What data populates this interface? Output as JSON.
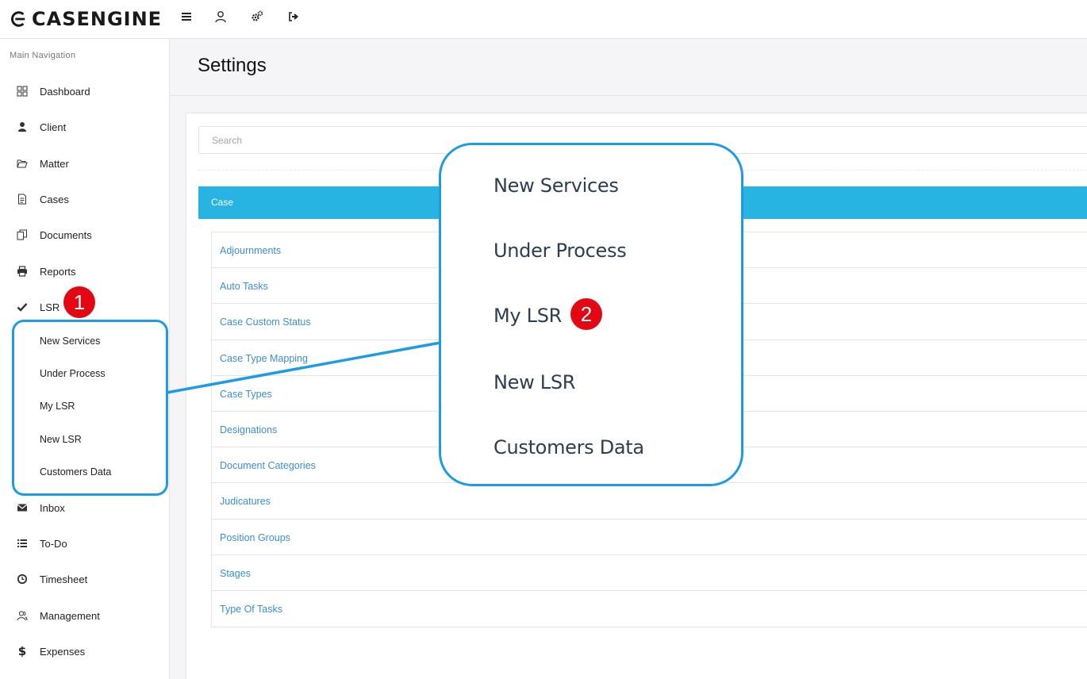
{
  "brand": {
    "name": "CASENGINE"
  },
  "topbar": {
    "icons": [
      "menu-icon",
      "user-icon",
      "settings-gears-icon",
      "logout-icon"
    ]
  },
  "sidebar": {
    "heading": "Main Navigation",
    "items": [
      {
        "label": "Dashboard",
        "icon": "grid-icon"
      },
      {
        "label": "Client",
        "icon": "user-icon"
      },
      {
        "label": "Matter",
        "icon": "folder-open-icon"
      },
      {
        "label": "Cases",
        "icon": "file-text-icon"
      },
      {
        "label": "Documents",
        "icon": "copy-icon"
      },
      {
        "label": "Reports",
        "icon": "printer-icon"
      },
      {
        "label": "LSR",
        "icon": "check-icon"
      },
      {
        "label": "Inbox",
        "icon": "envelope-icon"
      },
      {
        "label": "To-Do",
        "icon": "list-icon"
      },
      {
        "label": "Timesheet",
        "icon": "clock-icon"
      },
      {
        "label": "Management",
        "icon": "users-icon"
      },
      {
        "label": "Expenses",
        "icon": "dollar-icon"
      }
    ],
    "lsr_submenu": [
      "New Services",
      "Under Process",
      "My LSR",
      "New LSR",
      "Customers Data"
    ]
  },
  "main": {
    "title": "Settings",
    "search_placeholder": "Search",
    "section_title": "Case",
    "settings_items": [
      "Adjournments",
      "Auto Tasks",
      "Case Custom Status",
      "Case Type Mapping",
      "Case Types",
      "Designations",
      "Document Categories",
      "Judicatures",
      "Position Groups",
      "Stages",
      "Type Of Tasks"
    ]
  },
  "annotation": {
    "badge_1": "1",
    "badge_2": "2",
    "zoom_items": [
      "New Services",
      "Under Process",
      "My LSR",
      "New LSR",
      "Customers Data"
    ]
  },
  "colors": {
    "accent": "#27b4e2",
    "link": "#3b8ed3",
    "callout": "#1e9be6",
    "badge": "#e30613"
  }
}
